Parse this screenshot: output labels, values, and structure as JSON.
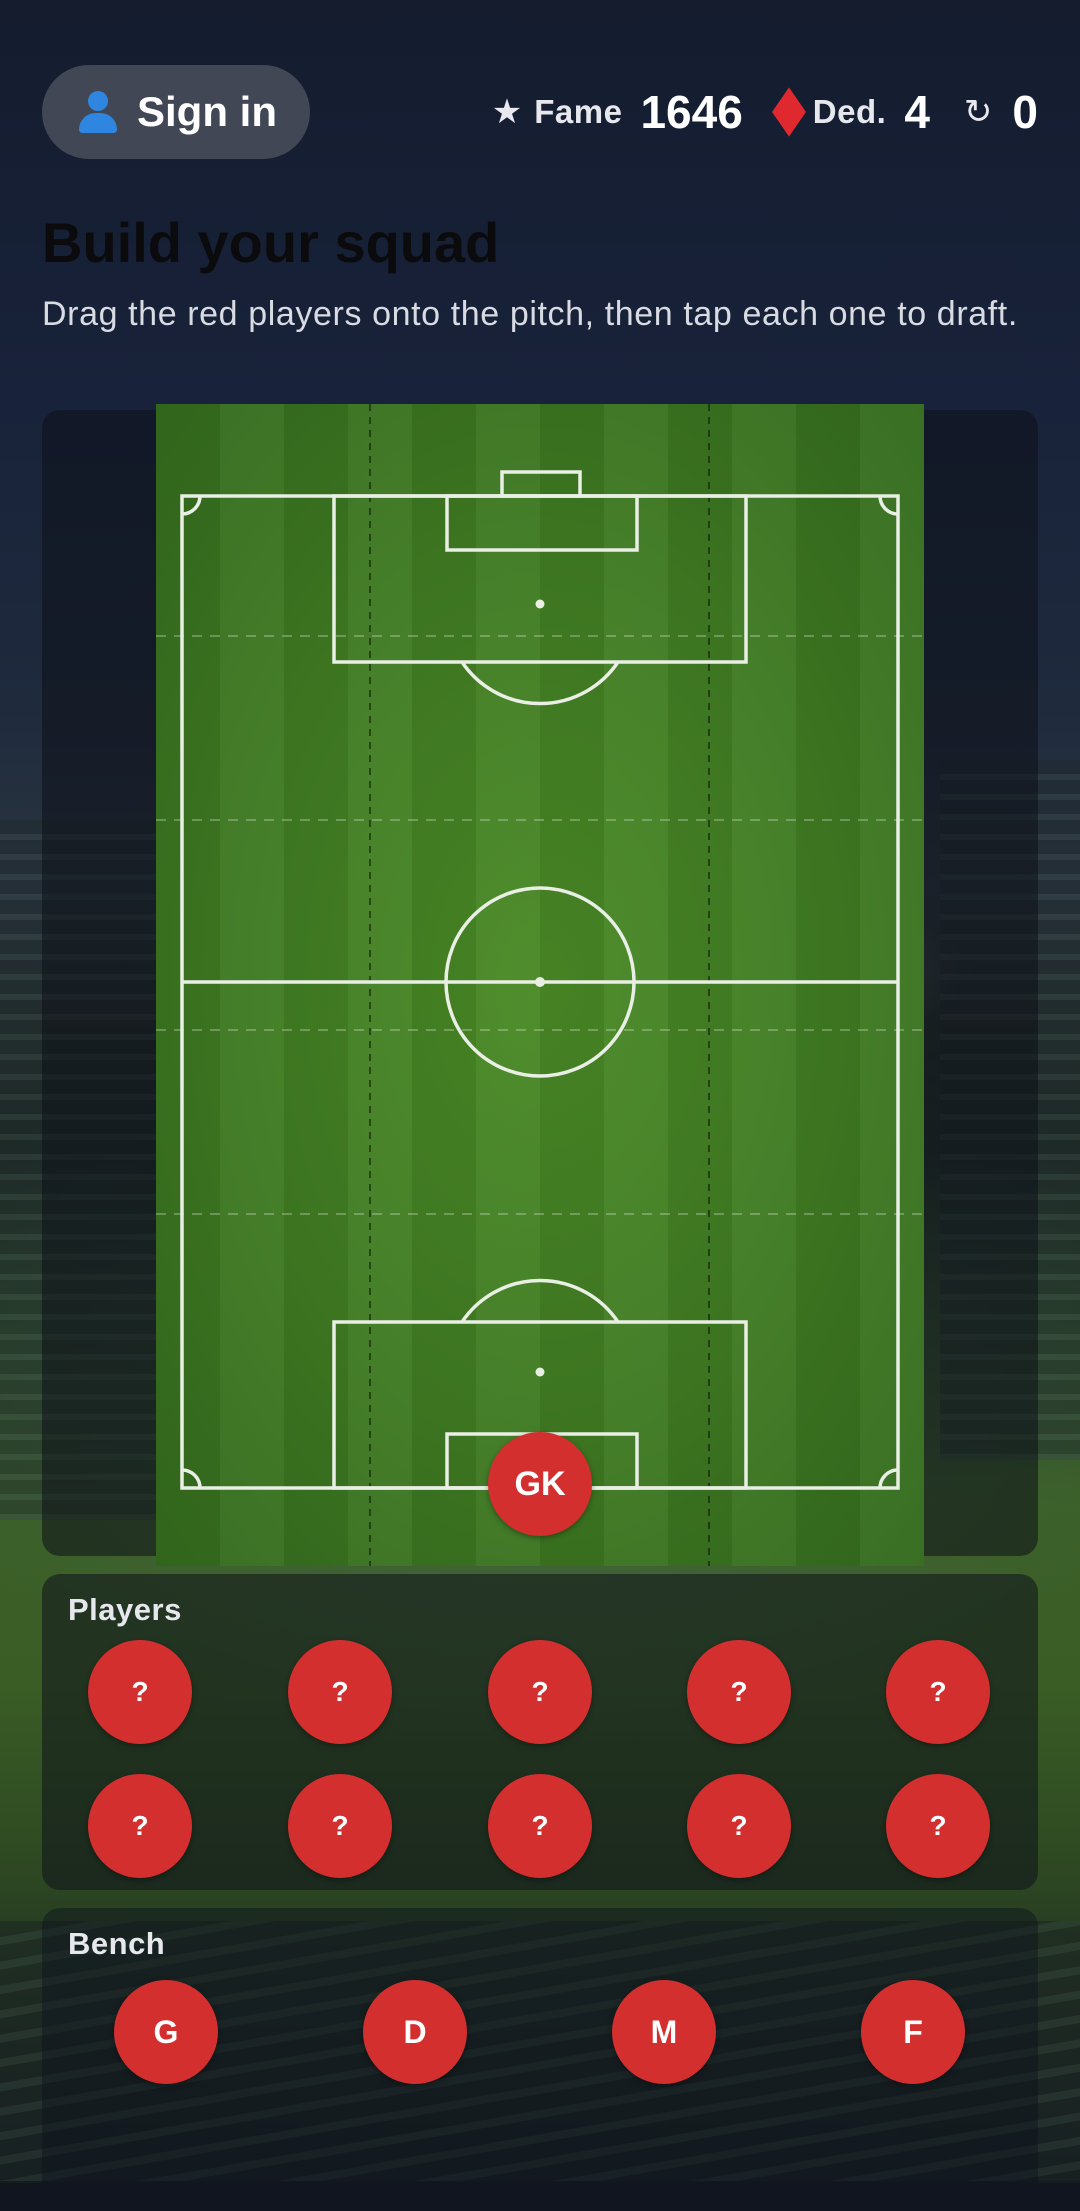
{
  "header": {
    "sign_in_label": "Sign in",
    "stats": [
      {
        "icon": "star-icon",
        "label": "Fame",
        "value": "1646"
      },
      {
        "icon": "diamond-icon",
        "label": "Ded.",
        "value": "4"
      },
      {
        "icon": "refresh-icon",
        "label": "",
        "value": "0"
      }
    ]
  },
  "page": {
    "title": "Build your squad",
    "subtitle": "Drag the red players onto the pitch, then tap each one to draft."
  },
  "pitch": {
    "goalkeeper_label": "GK"
  },
  "players": {
    "title": "Players",
    "slots": [
      "?",
      "?",
      "?",
      "?",
      "?",
      "?",
      "?",
      "?",
      "?",
      "?"
    ]
  },
  "bench": {
    "title": "Bench",
    "slots": [
      "G",
      "D",
      "M",
      "F"
    ]
  },
  "colors": {
    "player_token": "#d42f2f",
    "accent_blue": "#2f86e0",
    "diamond_red": "#e0282f"
  }
}
